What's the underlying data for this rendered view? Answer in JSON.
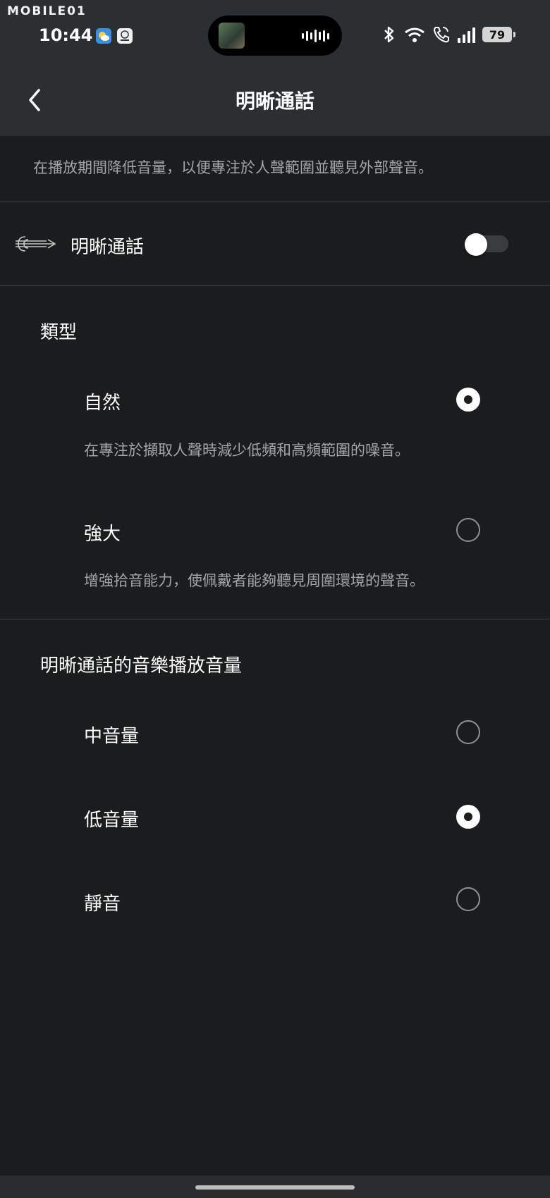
{
  "watermark": "MOBILE01",
  "status_bar": {
    "time": "10:44",
    "battery": "79",
    "icons": [
      "weather-app-icon",
      "audio-app-icon",
      "bluetooth-icon",
      "wifi-icon",
      "wifi-call-icon",
      "signal-icon",
      "battery-icon"
    ]
  },
  "header": {
    "title": "明晰通話",
    "back_icon": "chevron-left-icon"
  },
  "description": "在播放期間降低音量，以便專注於人聲範圍並聽見外部聲音。",
  "main_toggle": {
    "label": "明晰通話",
    "icon": "conversation-clarity-icon",
    "enabled": false
  },
  "type_section": {
    "title": "類型",
    "options": [
      {
        "label": "自然",
        "description": "在專注於擷取人聲時減少低頻和高頻範圍的噪音。",
        "selected": true
      },
      {
        "label": "強大",
        "description": "增強拾音能力，使佩戴者能夠聽見周圍環境的聲音。",
        "selected": false
      }
    ]
  },
  "volume_section": {
    "title": "明晰通話的音樂播放音量",
    "options": [
      {
        "label": "中音量",
        "selected": false
      },
      {
        "label": "低音量",
        "selected": true
      },
      {
        "label": "靜音",
        "selected": false
      }
    ]
  },
  "colors": {
    "background": "#1b1c1d",
    "header": "#2c2f32",
    "secondary_text": "#a4a6a8",
    "divider": "#3d4043"
  }
}
